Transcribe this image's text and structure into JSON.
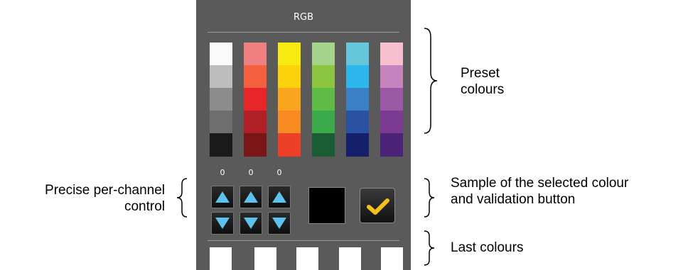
{
  "panel": {
    "title": "RGB",
    "background": "#5a5a5a"
  },
  "preset_colours": [
    [
      "#fafafa",
      "#bdbdbd",
      "#8c8c8c",
      "#6e6e6e",
      "#1a1a1a"
    ],
    [
      "#f08080",
      "#f4603f",
      "#e8262a",
      "#b01f26",
      "#7a1518"
    ],
    [
      "#f7ea10",
      "#fcd20c",
      "#f9a51e",
      "#f78b22",
      "#ee4026"
    ],
    [
      "#a6d38b",
      "#8cc540",
      "#5fba46",
      "#3aaa4a",
      "#1a5c34"
    ],
    [
      "#66c7dc",
      "#2eb7ec",
      "#3a80c4",
      "#2a52a2",
      "#15206a"
    ],
    [
      "#f8bfcf",
      "#c783bd",
      "#9b58a4",
      "#7b3b92",
      "#4d2378"
    ]
  ],
  "channel_counters": [
    "0",
    "0",
    "0"
  ],
  "arrow_color": "#5cc3ee",
  "sample_colour": "#000000",
  "checkmark_color": "#f3c01c",
  "last_colours": [
    "#ffffff",
    "#ffffff",
    "#ffffff",
    "#ffffff",
    "#ffffff"
  ],
  "annotations": {
    "preset": [
      "Preset",
      "colours"
    ],
    "precise": [
      "Precise per-channel",
      "control"
    ],
    "sample": [
      "Sample of the selected colour",
      "and validation button"
    ],
    "last": [
      "Last colours"
    ]
  }
}
